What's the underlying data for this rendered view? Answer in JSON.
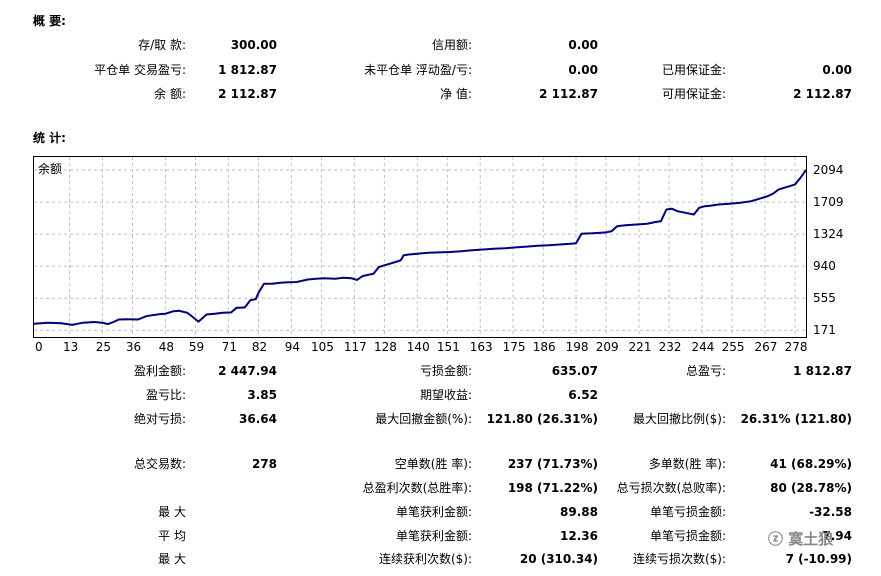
{
  "summary": {
    "title": "概 要:",
    "rows": [
      {
        "cells": [
          {
            "label": "存/取 款:",
            "value": "300.00"
          },
          {
            "label": "信用额:",
            "value": "0.00"
          },
          {
            "label": "",
            "value": ""
          }
        ]
      },
      {
        "cells": [
          {
            "label": "平仓单 交易盈亏:",
            "value": "1 812.87"
          },
          {
            "label": "未平仓单 浮动盈/亏:",
            "value": "0.00"
          },
          {
            "label": "已用保证金:",
            "value": "0.00"
          }
        ]
      },
      {
        "cells": [
          {
            "label": "余 额:",
            "value": "2 112.87"
          },
          {
            "label": "净 值:",
            "value": "2 112.87"
          },
          {
            "label": "可用保证金:",
            "value": "2 112.87"
          }
        ]
      }
    ]
  },
  "stats_title": "统 计:",
  "chart_data": {
    "type": "line",
    "title": "余额",
    "xlabel": "",
    "ylabel": "",
    "grid": true,
    "x_ticks": [
      0,
      13,
      25,
      36,
      48,
      59,
      71,
      82,
      94,
      105,
      117,
      128,
      140,
      151,
      163,
      175,
      186,
      198,
      209,
      221,
      232,
      244,
      255,
      267,
      278
    ],
    "y_ticks": [
      171,
      555,
      940,
      1324,
      1709,
      2094
    ],
    "xlim": [
      0,
      282
    ],
    "ylim": [
      90,
      2250
    ],
    "series": [
      {
        "color": "#00007f",
        "x": [
          0,
          5,
          10,
          14,
          16,
          18,
          22,
          25,
          27,
          29,
          31,
          34,
          38,
          41,
          43,
          46,
          48,
          51,
          53,
          56,
          58,
          60,
          61,
          63,
          66,
          69,
          72,
          74,
          75,
          77,
          79,
          81,
          82,
          84,
          87,
          90,
          92,
          96,
          100,
          103,
          106,
          110,
          113,
          116,
          118,
          120,
          122,
          124,
          126,
          128,
          130,
          132,
          134,
          135,
          137,
          140,
          144,
          148,
          152,
          156,
          160,
          164,
          168,
          172,
          176,
          180,
          184,
          188,
          192,
          196,
          198,
          200,
          204,
          207,
          209,
          211,
          213,
          216,
          220,
          224,
          227,
          229,
          231,
          233,
          235,
          238,
          241,
          243,
          245,
          247,
          250,
          254,
          258,
          262,
          265,
          268,
          270,
          272,
          274,
          276,
          278,
          280,
          282
        ],
        "y": [
          250,
          260,
          255,
          235,
          250,
          262,
          270,
          260,
          245,
          270,
          300,
          302,
          300,
          340,
          350,
          365,
          370,
          400,
          405,
          380,
          330,
          275,
          300,
          360,
          370,
          380,
          385,
          440,
          440,
          445,
          530,
          545,
          620,
          730,
          730,
          740,
          745,
          750,
          780,
          790,
          795,
          790,
          800,
          795,
          775,
          820,
          835,
          850,
          930,
          950,
          970,
          990,
          1010,
          1070,
          1080,
          1090,
          1100,
          1105,
          1110,
          1120,
          1130,
          1140,
          1150,
          1155,
          1165,
          1175,
          1185,
          1190,
          1200,
          1210,
          1215,
          1330,
          1335,
          1340,
          1345,
          1360,
          1420,
          1430,
          1440,
          1450,
          1470,
          1480,
          1620,
          1630,
          1600,
          1580,
          1560,
          1640,
          1660,
          1665,
          1680,
          1690,
          1700,
          1720,
          1750,
          1780,
          1810,
          1860,
          1880,
          1900,
          1920,
          2000,
          2094
        ]
      }
    ]
  },
  "stats": {
    "rows": [
      {
        "cells": [
          {
            "label": "盈利金额:",
            "value": "2 447.94"
          },
          {
            "label": "亏损金额:",
            "value": "635.07"
          },
          {
            "label": "总盈亏:",
            "value": "1 812.87"
          }
        ]
      },
      {
        "cells": [
          {
            "label": "盈亏比:",
            "value": "3.85"
          },
          {
            "label": "期望收益:",
            "value": "6.52"
          },
          {
            "label": "",
            "value": ""
          }
        ]
      },
      {
        "cells": [
          {
            "label": "绝对亏损:",
            "value": "36.64"
          },
          {
            "label": "最大回撤金额(%):",
            "value": "121.80 (26.31%)"
          },
          {
            "label": "最大回撤比例($):",
            "value": "26.31% (121.80)"
          }
        ]
      }
    ]
  },
  "trades": {
    "rows": [
      {
        "cells": [
          {
            "label": "总交易数:",
            "value": "278"
          },
          {
            "label": "空单数(胜 率):",
            "value": "237 (71.73%)"
          },
          {
            "label": "多单数(胜 率):",
            "value": "41 (68.29%)"
          }
        ]
      },
      {
        "cells": [
          {
            "label": "",
            "value": ""
          },
          {
            "label": "总盈利次数(总胜率):",
            "value": "198 (71.22%)"
          },
          {
            "label": "总亏损次数(总败率):",
            "value": "80 (28.78%)"
          }
        ]
      },
      {
        "cells": [
          {
            "label": "最 大",
            "value": ""
          },
          {
            "label": "单笔获利金额:",
            "value": "89.88"
          },
          {
            "label": "单笔亏损金额:",
            "value": "-32.58"
          }
        ]
      },
      {
        "cells": [
          {
            "label": "平 均",
            "value": ""
          },
          {
            "label": "单笔获利金额:",
            "value": "12.36"
          },
          {
            "label": "单笔亏损金额:",
            "value": "7.94"
          }
        ]
      },
      {
        "cells": [
          {
            "label": "最 大",
            "value": ""
          },
          {
            "label": "连续获利次数($):",
            "value": "20 (310.34)"
          },
          {
            "label": "连续亏损次数($):",
            "value": "7 (-10.99)"
          }
        ]
      }
    ]
  },
  "watermark": "ⓩ 寞土狼"
}
